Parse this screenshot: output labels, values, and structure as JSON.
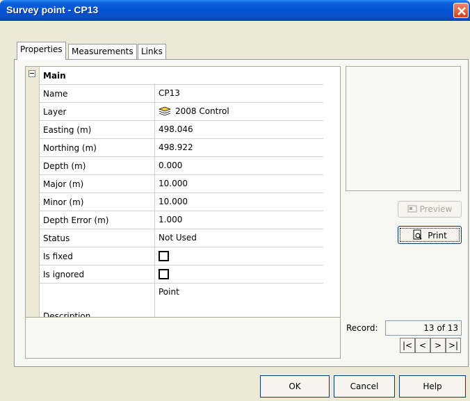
{
  "window": {
    "title": "Survey point - CP13"
  },
  "tabs": [
    {
      "label": "Properties",
      "active": true
    },
    {
      "label": "Measurements",
      "active": false
    },
    {
      "label": "Links",
      "active": false
    }
  ],
  "grid": {
    "section": "Main",
    "rows": [
      {
        "name": "Name",
        "value": "CP13"
      },
      {
        "name": "Layer",
        "value": "2008 Control",
        "icon": "layer-icon"
      },
      {
        "name": "Easting (m)",
        "value": "498.046"
      },
      {
        "name": "Northing (m)",
        "value": "498.922"
      },
      {
        "name": "Depth (m)",
        "value": "0.000"
      },
      {
        "name": "Major (m)",
        "value": "10.000"
      },
      {
        "name": "Minor (m)",
        "value": "10.000"
      },
      {
        "name": "Depth Error (m)",
        "value": "1.000"
      },
      {
        "name": "Status",
        "value": "Not Used"
      },
      {
        "name": "Is fixed",
        "checked": false
      },
      {
        "name": "Is ignored",
        "checked": false
      },
      {
        "name": "Description",
        "value": "Point"
      }
    ]
  },
  "side": {
    "preview_label": "Preview",
    "print_label": "Print",
    "record_label": "Record:",
    "record_value": "13 of 13",
    "nav": {
      "first": "|<",
      "prev": "<",
      "next": ">",
      "last": ">|"
    }
  },
  "buttons": {
    "ok": "OK",
    "cancel": "Cancel",
    "help": "Help"
  },
  "colors": {
    "titlebar": "#0553d3",
    "close": "#d2401c",
    "face": "#ece9d8"
  }
}
